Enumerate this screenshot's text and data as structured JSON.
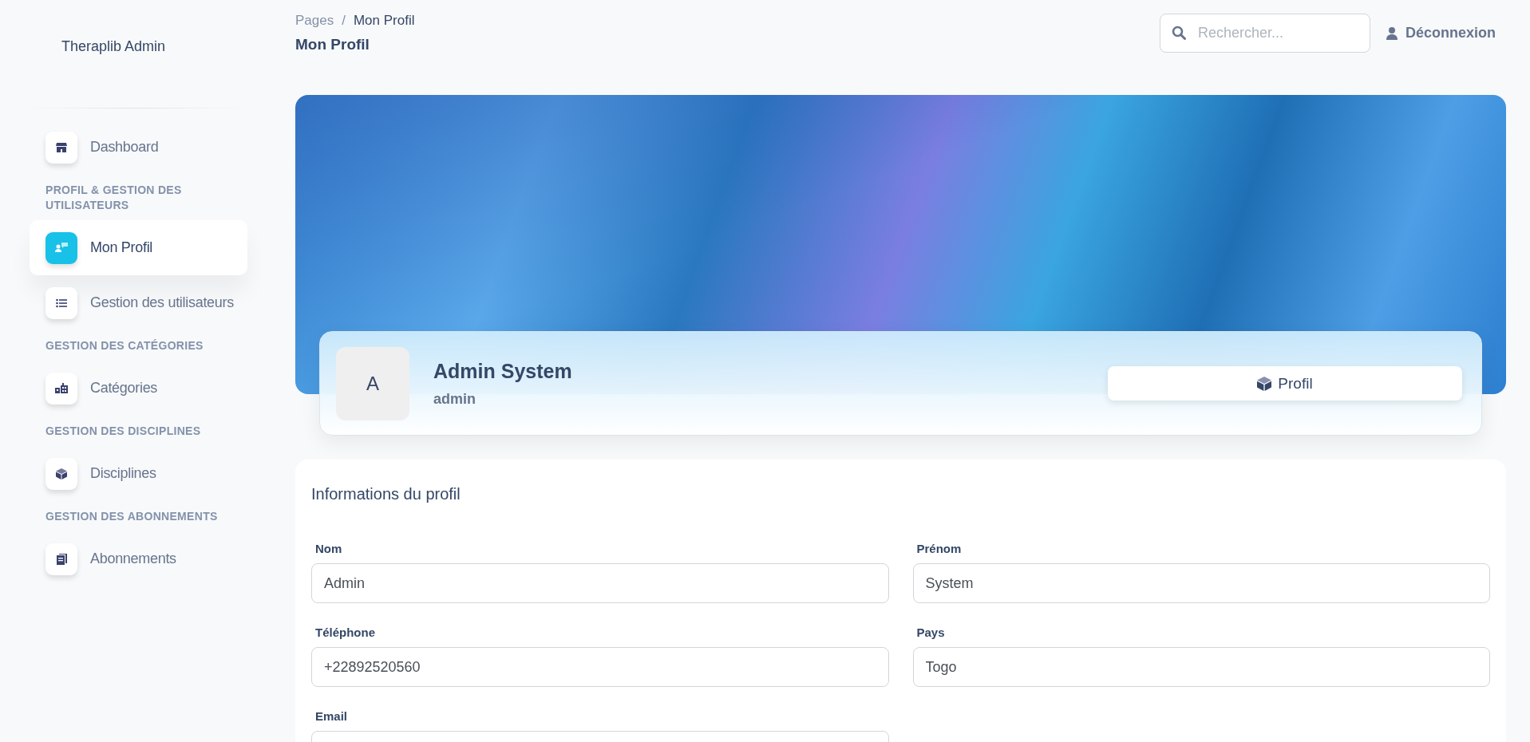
{
  "sidebar": {
    "brand": "Theraplib Admin",
    "items": [
      {
        "kind": "link",
        "label": "Dashboard",
        "selected": false
      },
      {
        "kind": "header",
        "label": "PROFIL & GESTION DES UTILISATEURS"
      },
      {
        "kind": "link",
        "label": "Mon Profil",
        "selected": true
      },
      {
        "kind": "link",
        "label": "Gestion des utilisateurs",
        "selected": false
      },
      {
        "kind": "header",
        "label": "GESTION DES CATÉGORIES"
      },
      {
        "kind": "link",
        "label": "Catégories",
        "selected": false
      },
      {
        "kind": "header",
        "label": "GESTION DES DISCIPLINES"
      },
      {
        "kind": "link",
        "label": "Disciplines",
        "selected": false
      },
      {
        "kind": "header",
        "label": "GESTION DES ABONNEMENTS"
      },
      {
        "kind": "link",
        "label": "Abonnements",
        "selected": false
      }
    ]
  },
  "header": {
    "breadcrumb": [
      "Pages",
      "/",
      "Mon Profil"
    ],
    "title": "Mon Profil",
    "search": {
      "placeholder": "Rechercher..."
    },
    "logout": "Déconnexion"
  },
  "profile": {
    "avatar": "A",
    "name": "Admin System",
    "role": "admin",
    "button": "Profil"
  },
  "form": {
    "title": "Informations du profil",
    "fields": [
      {
        "label": "Nom",
        "value": "Admin"
      },
      {
        "label": "Prénom",
        "value": "System"
      },
      {
        "label": "Téléphone",
        "value": "+22892520560"
      },
      {
        "label": "Pays",
        "value": "Togo"
      },
      {
        "label": "Email"
      }
    ]
  }
}
